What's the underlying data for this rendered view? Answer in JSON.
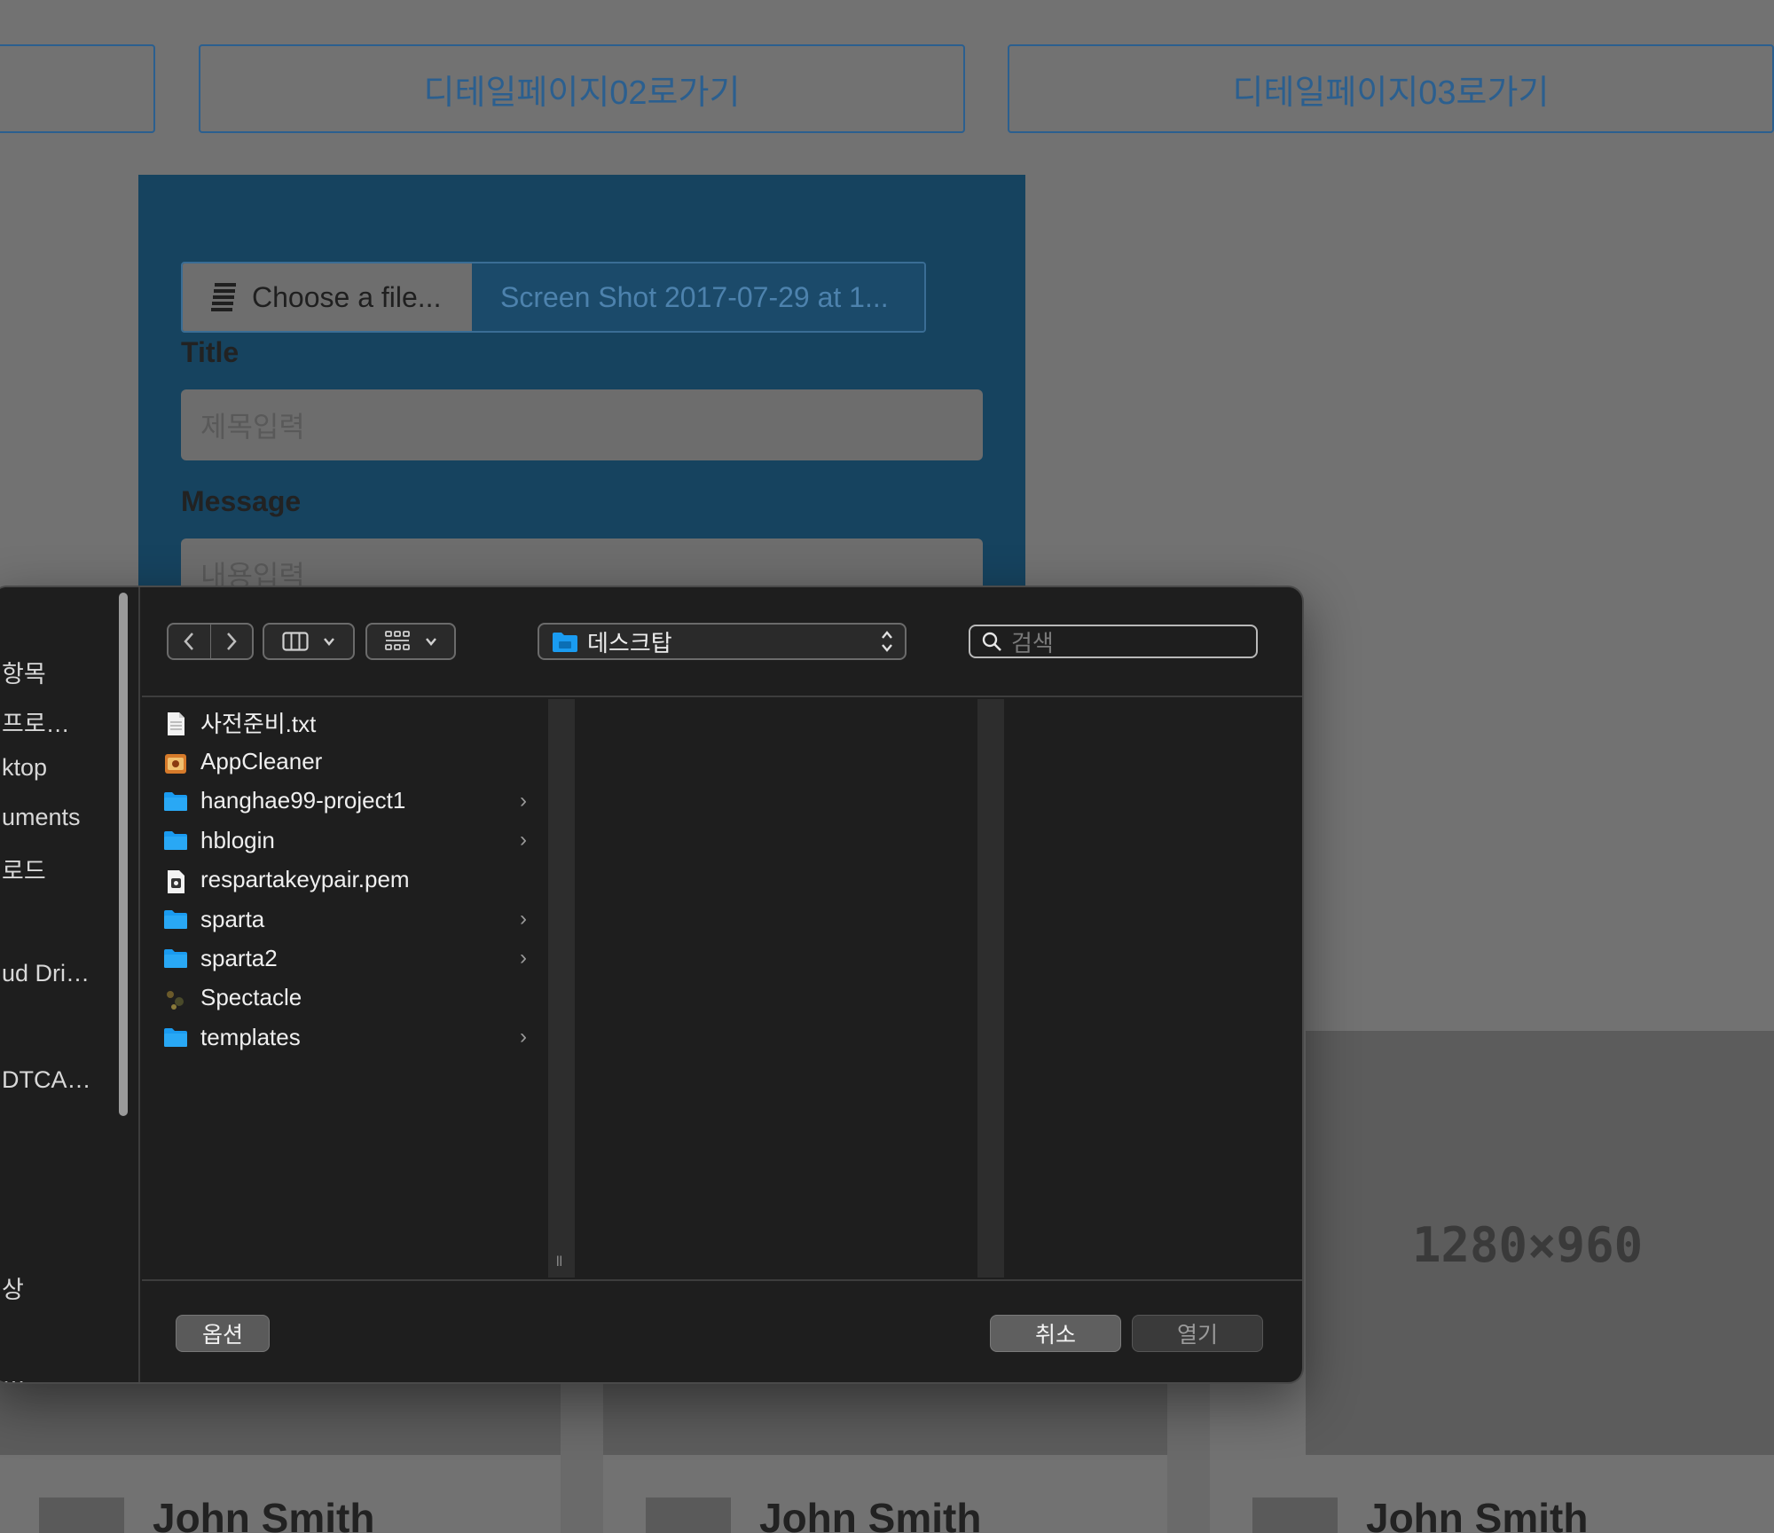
{
  "nav": {
    "prev_label": "",
    "detail02": "디테일페이지02로가기",
    "detail03": "디테일페이지03로가기"
  },
  "form": {
    "choose_file": "Choose a file...",
    "file_name": "Screen Shot 2017-07-29 at 1...",
    "title_label": "Title",
    "title_placeholder": "제목입력",
    "message_label": "Message",
    "message_placeholder": "내용입력"
  },
  "cards": {
    "image_placeholder": "1280×960",
    "authors": [
      "John Smith",
      "John Smith",
      "John Smith"
    ]
  },
  "dialog": {
    "sidebar": [
      "항목",
      "프로…",
      "ktop",
      "uments",
      "로드",
      "ud Dri…",
      "DTCA…",
      "상",
      "…"
    ],
    "location": "데스크탑",
    "search_placeholder": "검색",
    "files": [
      {
        "name": "사전준비.txt",
        "icon": "text-file-icon",
        "folder": false
      },
      {
        "name": "AppCleaner",
        "icon": "app-icon",
        "folder": false
      },
      {
        "name": "hanghae99-project1",
        "icon": "folder-icon",
        "folder": true
      },
      {
        "name": "hblogin",
        "icon": "folder-icon",
        "folder": true
      },
      {
        "name": "respartakeypair.pem",
        "icon": "certificate-file-icon",
        "folder": false
      },
      {
        "name": "sparta",
        "icon": "folder-icon",
        "folder": true
      },
      {
        "name": "sparta2",
        "icon": "folder-icon",
        "folder": true
      },
      {
        "name": "Spectacle",
        "icon": "app-icon",
        "folder": false
      },
      {
        "name": "templates",
        "icon": "folder-icon",
        "folder": true
      }
    ],
    "options": "옵션",
    "cancel": "취소",
    "open": "열기"
  },
  "colors": {
    "folder_blue": "#1a9bf0",
    "panel_blue": "#16435f",
    "dialog_bg": "#1e1e1e"
  }
}
